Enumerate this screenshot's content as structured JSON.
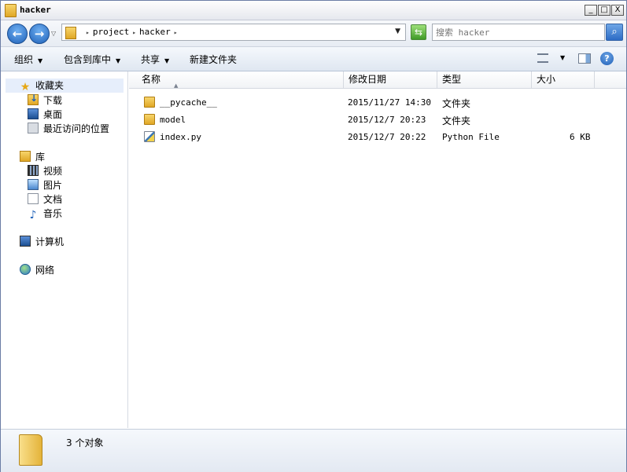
{
  "window": {
    "title": "hacker"
  },
  "window_controls": {
    "minimize": "_",
    "maximize": "□",
    "close": "X"
  },
  "address": {
    "crumbs": [
      "project",
      "hacker"
    ],
    "search_placeholder": "搜索 hacker"
  },
  "toolbar": {
    "organize": "组织",
    "include_in_library": "包含到库中",
    "share": "共享",
    "new_folder": "新建文件夹",
    "help": "?"
  },
  "sidebar": {
    "favorites": {
      "label": "收藏夹",
      "items": [
        "下载",
        "桌面",
        "最近访问的位置"
      ]
    },
    "libraries": {
      "label": "库",
      "items": [
        "视频",
        "图片",
        "文档",
        "音乐"
      ]
    },
    "computer": "计算机",
    "network": "网络"
  },
  "columns": {
    "name": "名称",
    "modified": "修改日期",
    "type": "类型",
    "size": "大小"
  },
  "files": [
    {
      "name": "__pycache__",
      "modified": "2015/11/27 14:30",
      "type": "文件夹",
      "size": "",
      "icon": "folder-icon"
    },
    {
      "name": "model",
      "modified": "2015/12/7 20:23",
      "type": "文件夹",
      "size": "",
      "icon": "folder-icon"
    },
    {
      "name": "index.py",
      "modified": "2015/12/7 20:22",
      "type": "Python File",
      "size": "6 KB",
      "icon": "python-file-icon"
    }
  ],
  "status": {
    "count_text": "3 个对象"
  }
}
